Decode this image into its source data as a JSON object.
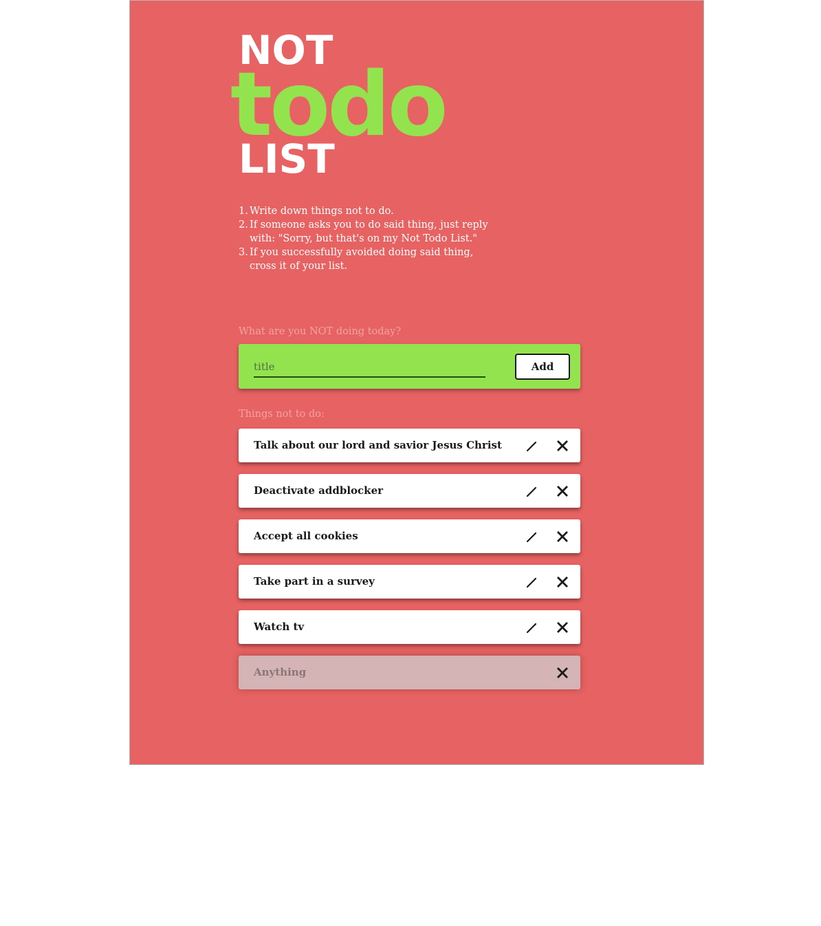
{
  "header": {
    "word_not": "NOT",
    "word_todo": "todo",
    "word_list": "LIST"
  },
  "instructions": [
    {
      "num": "1.",
      "text": "Write down things not to do."
    },
    {
      "num": "2.",
      "text": "If someone asks you to do said thing, just reply with: \"Sorry, but that's on my Not Todo List.\""
    },
    {
      "num": "3.",
      "text": "If you successfully avoided doing said thing, cross it of your list."
    }
  ],
  "add_form": {
    "label": "What are you NOT doing today?",
    "input_placeholder": "title",
    "input_value": "",
    "button_label": "Add"
  },
  "list": {
    "label": "Things not to do:",
    "items": [
      {
        "title": "Talk about our lord and savior Jesus Christ",
        "done": false
      },
      {
        "title": "Deactivate addblocker",
        "done": false
      },
      {
        "title": "Accept all cookies",
        "done": false
      },
      {
        "title": "Take part in a survey",
        "done": false
      },
      {
        "title": "Watch tv",
        "done": false
      },
      {
        "title": "Anything",
        "done": true
      }
    ]
  },
  "colors": {
    "background": "#e76262",
    "accent_green": "#93e34f",
    "card": "#ffffff",
    "card_done": "#d4b4b4"
  },
  "icons": {
    "edit": "pencil-icon",
    "delete": "close-icon"
  }
}
